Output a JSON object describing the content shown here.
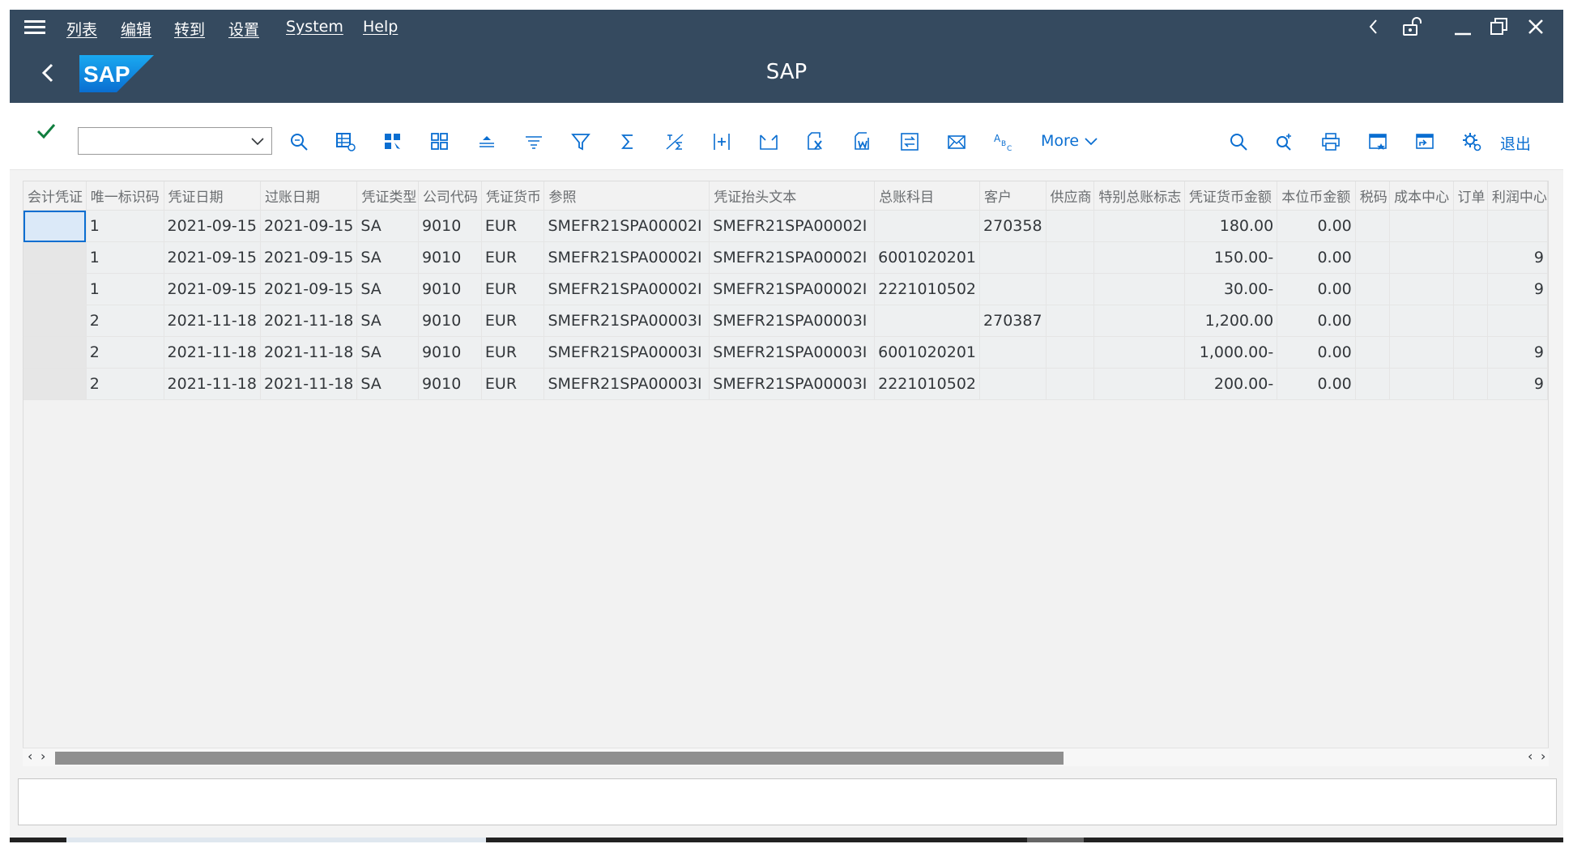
{
  "menubar": {
    "items": [
      "列表",
      "编辑",
      "转到",
      "设置",
      "System",
      "Help"
    ]
  },
  "titlebar": {
    "logo_text": "SAP",
    "title": "SAP"
  },
  "toolbar": {
    "command_value": "",
    "more_label": "More",
    "exit_label": "退出"
  },
  "grid": {
    "columns": [
      "会计凭证",
      "唯一标识码",
      "凭证日期",
      "过账日期",
      "凭证类型",
      "公司代码",
      "凭证货币",
      "参照",
      "凭证抬头文本",
      "总账科目",
      "客户",
      "供应商",
      "特别总账标志",
      "凭证货币金额",
      "本位币金额",
      "税码",
      "成本中心",
      "订单",
      "利润中心"
    ],
    "rows": [
      [
        "",
        "1",
        "2021-09-15",
        "2021-09-15",
        "SA",
        "9010",
        "EUR",
        "SMEFR21SPA00002I",
        "SMEFR21SPA00002I",
        "",
        "270358",
        "",
        "",
        "180.00",
        "0.00",
        "",
        "",
        "",
        ""
      ],
      [
        "",
        "1",
        "2021-09-15",
        "2021-09-15",
        "SA",
        "9010",
        "EUR",
        "SMEFR21SPA00002I",
        "SMEFR21SPA00002I",
        "6001020201",
        "",
        "",
        "",
        "150.00-",
        "0.00",
        "",
        "",
        "",
        "9"
      ],
      [
        "",
        "1",
        "2021-09-15",
        "2021-09-15",
        "SA",
        "9010",
        "EUR",
        "SMEFR21SPA00002I",
        "SMEFR21SPA00002I",
        "2221010502",
        "",
        "",
        "",
        "30.00-",
        "0.00",
        "",
        "",
        "",
        "9"
      ],
      [
        "",
        "2",
        "2021-11-18",
        "2021-11-18",
        "SA",
        "9010",
        "EUR",
        "SMEFR21SPA00003I",
        "SMEFR21SPA00003I",
        "",
        "270387",
        "",
        "",
        "1,200.00",
        "0.00",
        "",
        "",
        "",
        ""
      ],
      [
        "",
        "2",
        "2021-11-18",
        "2021-11-18",
        "SA",
        "9010",
        "EUR",
        "SMEFR21SPA00003I",
        "SMEFR21SPA00003I",
        "6001020201",
        "",
        "",
        "",
        "1,000.00-",
        "0.00",
        "",
        "",
        "",
        "9"
      ],
      [
        "",
        "2",
        "2021-11-18",
        "2021-11-18",
        "SA",
        "9010",
        "EUR",
        "SMEFR21SPA00003I",
        "SMEFR21SPA00003I",
        "2221010502",
        "",
        "",
        "",
        "200.00-",
        "0.00",
        "",
        "",
        "",
        "9"
      ]
    ],
    "scroll_fraction": 0.69
  },
  "status": {
    "message": ""
  },
  "colors": {
    "shell": "#354a5f",
    "accent": "#0a6ed1",
    "check": "#107e3e"
  }
}
